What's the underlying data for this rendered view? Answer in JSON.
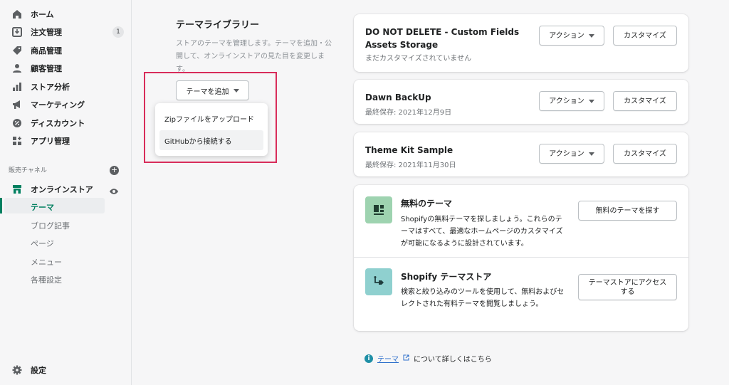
{
  "sidebar": {
    "items": [
      {
        "label": "ホーム",
        "icon": "home-icon"
      },
      {
        "label": "注文管理",
        "icon": "orders-icon",
        "badge": "1"
      },
      {
        "label": "商品管理",
        "icon": "products-icon"
      },
      {
        "label": "顧客管理",
        "icon": "customers-icon"
      },
      {
        "label": "ストア分析",
        "icon": "analytics-icon"
      },
      {
        "label": "マーケティング",
        "icon": "marketing-icon"
      },
      {
        "label": "ディスカウント",
        "icon": "discount-icon"
      },
      {
        "label": "アプリ管理",
        "icon": "apps-icon"
      }
    ],
    "channels_label": "販売チャネル",
    "online_store": {
      "label": "オンラインストア",
      "icon": "store-icon"
    },
    "sub_items": [
      "テーマ",
      "ブログ記事",
      "ページ",
      "メニュー",
      "各種設定"
    ],
    "settings_label": "設定"
  },
  "library": {
    "title": "テーマライブラリー",
    "description": "ストアのテーマを管理します。テーマを追加・公開して、オンラインストアの見た目を変更します。",
    "add_button": "テーマを追加",
    "dropdown": [
      "Zipファイルをアップロード",
      "GitHubから接続する"
    ]
  },
  "themes": [
    {
      "name": "DO NOT DELETE - Custom Fields Assets Storage",
      "sub": "まだカスタマイズされていません"
    },
    {
      "name": "Dawn BackUp",
      "sub": "最終保存: 2021年12月9日"
    },
    {
      "name": "Theme Kit Sample",
      "sub": "最終保存: 2021年11月30日"
    }
  ],
  "buttons": {
    "action": "アクション",
    "customize": "カスタマイズ"
  },
  "free_themes": {
    "title": "無料のテーマ",
    "description": "Shopifyの無料テーマを探しましょう。これらのテーマはすべて、最適なホームページのカスタマイズが可能になるように設計されています。",
    "button": "無料のテーマを探す"
  },
  "theme_store": {
    "title": "Shopify テーマストア",
    "description": "検索と絞り込みのツールを使用して、無料およびセレクトされた有料テーマを閲覧しましょう。",
    "button": "テーマストアにアクセスする"
  },
  "footer": {
    "link": "テーマ",
    "text": "について詳しくはこちら"
  },
  "colors": {
    "accent": "#008060",
    "highlight": "#d82c5a",
    "free_icon_bg": "#9ed3b0",
    "store_icon_bg": "#8fd0cf"
  }
}
